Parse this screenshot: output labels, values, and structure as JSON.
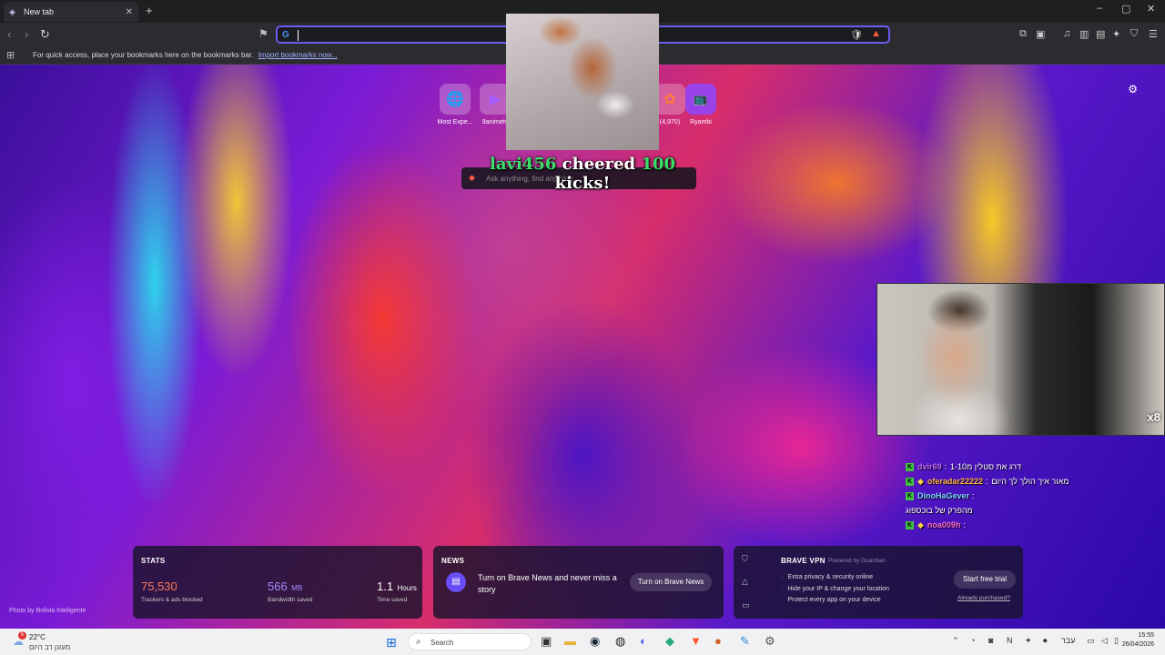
{
  "tab": {
    "title": "New tab",
    "close": "✕",
    "new": "+"
  },
  "window": {
    "minimize": "–",
    "maximize": "▢",
    "close": "✕"
  },
  "address": {
    "value": "",
    "placeholder": ""
  },
  "bookmarks_bar": {
    "text": "For quick access, place your bookmarks here on the bookmarks bar.",
    "link": "Import bookmarks now..."
  },
  "top_sites": [
    {
      "label": "Most Expe...",
      "icon": "🌐"
    },
    {
      "label": "9animetv",
      "icon": "▶"
    },
    {
      "label": "(4,970)",
      "icon": "✿"
    },
    {
      "label": "Ryambi",
      "icon": "📺"
    }
  ],
  "overlay": {
    "cheer_user": "lavi456",
    "cheer_mid": "cheered",
    "cheer_amount": "100",
    "cheer_end": "kicks!",
    "ask_placeholder": "Ask anything, find anything...",
    "webcam_badge": "x8"
  },
  "chat": [
    {
      "user": "dvir69",
      "msg": "דרג את סטלין מ1-10",
      "user_color": "#c56cff",
      "diamond": false
    },
    {
      "user": "oferadar22222",
      "msg": "מאור איך הולך לך היום",
      "user_color": "#ffb347",
      "diamond": true
    },
    {
      "user": "DinoHaGever",
      "msg": "",
      "user_color": "#7ed6ff",
      "diamond": false
    },
    {
      "user": "",
      "msg": "מהפרק של בוכספוג",
      "user_color": "#ffffff",
      "diamond": false
    },
    {
      "user": "noa009h",
      "msg": "",
      "user_color": "#ff6fd8",
      "diamond": true
    }
  ],
  "stats": {
    "title": "STATS",
    "trackers_value": "75,530",
    "trackers_label": "Trackers & ads blocked",
    "bandwidth_value": "566",
    "bandwidth_unit": "MB",
    "bandwidth_label": "Bandwidth saved",
    "time_value": "1.1",
    "time_unit": "Hours",
    "time_label": "Time saved"
  },
  "news": {
    "title": "NEWS",
    "text": "Turn on Brave News and never miss a story",
    "button": "Turn on Brave News"
  },
  "vpn": {
    "title": "BRAVE VPN",
    "powered": "Powered by Guardian",
    "features": [
      "Extra privacy & security online",
      "Hide your IP & change your location",
      "Protect every app on your device"
    ],
    "button": "Start free trial",
    "link": "Already purchased?"
  },
  "photo_credit": "Photo by Bolivia Inteligente",
  "taskbar": {
    "weather_temp": "22°C",
    "weather_desc": "מעונן רב היום",
    "weather_badge": "5",
    "search": "Search",
    "lang": "עבר",
    "time": "15:55",
    "date": "26/04/2026"
  },
  "colors": {
    "accent": "#6a5cf2",
    "stats_trackers": "#ff7a5a",
    "stats_bandwidth": "#a48cff",
    "kick_green": "#3be06a"
  }
}
